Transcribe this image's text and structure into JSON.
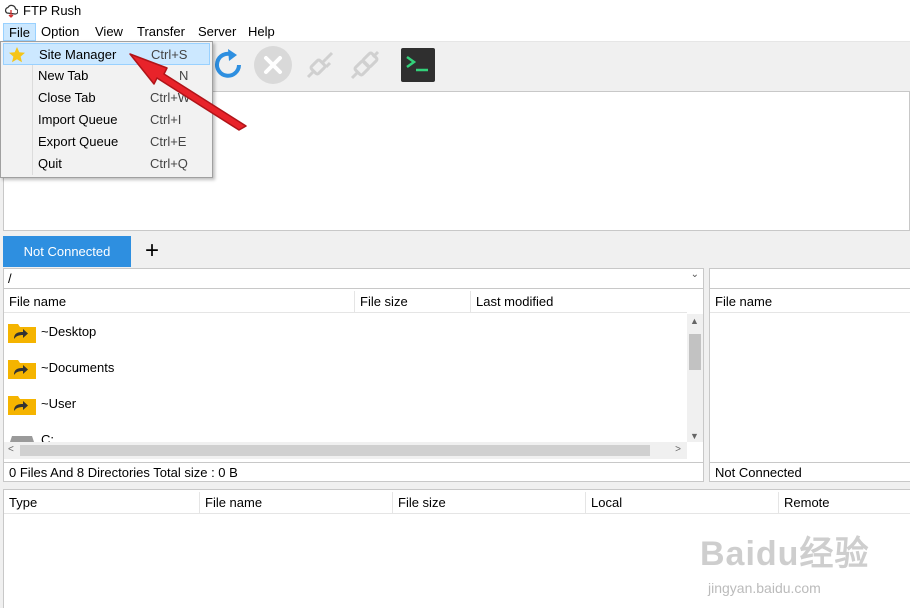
{
  "window": {
    "title": "FTP Rush"
  },
  "menubar": {
    "items": [
      {
        "label": "File",
        "active": true
      },
      {
        "label": "Option"
      },
      {
        "label": "View"
      },
      {
        "label": "Transfer"
      },
      {
        "label": "Server"
      },
      {
        "label": "Help"
      }
    ]
  },
  "file_menu": {
    "items": [
      {
        "label": "Site Manager",
        "shortcut": "Ctrl+S",
        "icon": "star-icon",
        "highlighted": true
      },
      {
        "label": "New Tab",
        "shortcut": "N"
      },
      {
        "label": "Close Tab",
        "shortcut": "Ctrl+W"
      },
      {
        "label": "Import Queue",
        "shortcut": "Ctrl+I"
      },
      {
        "label": "Export Queue",
        "shortcut": "Ctrl+E"
      },
      {
        "label": "Quit",
        "shortcut": "Ctrl+Q"
      }
    ]
  },
  "toolbar": {
    "icons": [
      "refresh-icon",
      "stop-icon",
      "disconnect-icon",
      "plug-icon",
      "terminal-icon"
    ],
    "terminal_glyph": ">_"
  },
  "tabs": {
    "active_label": "Not Connected",
    "add_label": "+"
  },
  "local": {
    "path": "/",
    "columns": [
      "File name",
      "File size",
      "Last modified"
    ],
    "rows": [
      {
        "name": "~Desktop",
        "icon": "folder-shortcut-icon"
      },
      {
        "name": "~Documents",
        "icon": "folder-shortcut-icon"
      },
      {
        "name": "~User",
        "icon": "folder-shortcut-icon"
      },
      {
        "name": "C:",
        "icon": "drive-icon"
      }
    ],
    "status": "0 Files And 8 Directories Total size : 0 B"
  },
  "remote": {
    "columns": [
      "File name"
    ],
    "status": "Not Connected"
  },
  "queue": {
    "columns": [
      "Type",
      "File name",
      "File size",
      "Local",
      "Remote"
    ]
  },
  "watermark": {
    "logo": "Baidu经验",
    "url": "jingyan.baidu.com"
  },
  "colors": {
    "accent": "#2e8fe0",
    "arrow": "#e8232a",
    "menu_highlight": "#cce8ff",
    "folder": "#f5b400"
  }
}
